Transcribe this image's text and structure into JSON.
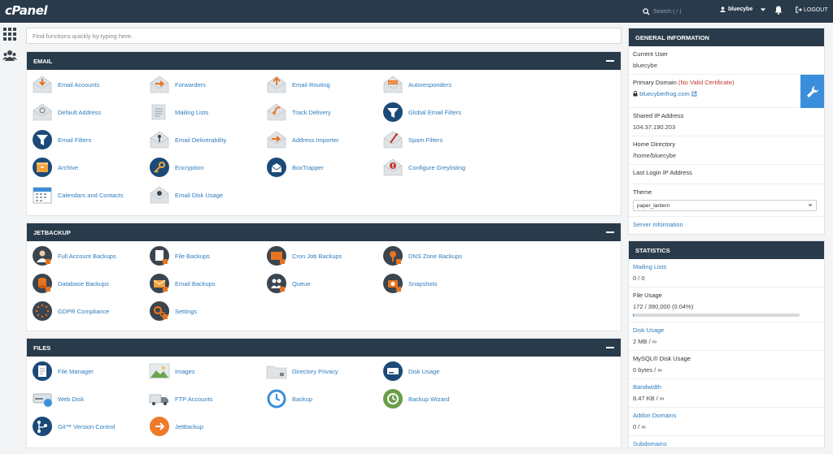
{
  "topbar": {
    "logo": "cPanel",
    "search_placeholder": "Search ( / )",
    "username": "bluecybe",
    "logout": "LOGOUT"
  },
  "quick_search": {
    "placeholder": "Find functions quickly by typing here."
  },
  "sections": [
    {
      "title": "EMAIL",
      "items": [
        {
          "label": "Email Accounts",
          "icon": "envelope-arrow-down-icon"
        },
        {
          "label": "Forwarders",
          "icon": "envelope-arrow-right-icon"
        },
        {
          "label": "Email Routing",
          "icon": "envelope-route-icon"
        },
        {
          "label": "Autoresponders",
          "icon": "envelope-auto-icon"
        },
        {
          "label": "Default Address",
          "icon": "envelope-at-icon"
        },
        {
          "label": "Mailing Lists",
          "icon": "envelope-list-icon"
        },
        {
          "label": "Track Delivery",
          "icon": "envelope-track-icon"
        },
        {
          "label": "Global Email Filters",
          "icon": "globe-filter-icon"
        },
        {
          "label": "Email Filters",
          "icon": "funnel-icon"
        },
        {
          "label": "Email Deliverability",
          "icon": "envelope-key-icon"
        },
        {
          "label": "Address Importer",
          "icon": "envelope-import-icon"
        },
        {
          "label": "Spam Filters",
          "icon": "envelope-spam-icon"
        },
        {
          "label": "Archive",
          "icon": "archive-icon"
        },
        {
          "label": "Encryption",
          "icon": "key-icon"
        },
        {
          "label": "BoxTrapper",
          "icon": "boxtrapper-icon"
        },
        {
          "label": "Configure Greylisting",
          "icon": "greylisting-icon"
        },
        {
          "label": "Calendars and Contacts",
          "icon": "calendar-icon"
        },
        {
          "label": "Email Disk Usage",
          "icon": "envelope-disk-icon"
        }
      ]
    },
    {
      "title": "JETBACKUP",
      "items": [
        {
          "label": "Full Account Backups",
          "icon": "user-backup-icon"
        },
        {
          "label": "File Backups",
          "icon": "file-backup-icon"
        },
        {
          "label": "Cron Job Backups",
          "icon": "cron-backup-icon"
        },
        {
          "label": "DNS Zone Backups",
          "icon": "dns-backup-icon"
        },
        {
          "label": "Database Backups",
          "icon": "database-backup-icon"
        },
        {
          "label": "Email Backups",
          "icon": "email-backup-icon"
        },
        {
          "label": "Queue",
          "icon": "queue-icon"
        },
        {
          "label": "Snapshots",
          "icon": "snapshot-icon"
        },
        {
          "label": "GDPR Compliance",
          "icon": "gdpr-icon"
        },
        {
          "label": "Settings",
          "icon": "settings-gear-icon"
        }
      ]
    },
    {
      "title": "FILES",
      "items": [
        {
          "label": "File Manager",
          "icon": "file-manager-icon"
        },
        {
          "label": "Images",
          "icon": "image-icon"
        },
        {
          "label": "Directory Privacy",
          "icon": "folder-lock-icon"
        },
        {
          "label": "Disk Usage",
          "icon": "disk-usage-icon"
        },
        {
          "label": "Web Disk",
          "icon": "web-disk-icon"
        },
        {
          "label": "FTP Accounts",
          "icon": "ftp-truck-icon"
        },
        {
          "label": "Backup",
          "icon": "backup-clock-icon"
        },
        {
          "label": "Backup Wizard",
          "icon": "backup-wizard-icon"
        },
        {
          "label": "Git™ Version Control",
          "icon": "git-icon"
        },
        {
          "label": "JetBackup",
          "icon": "jetbackup-icon"
        }
      ]
    }
  ],
  "general": {
    "title": "GENERAL INFORMATION",
    "current_user_label": "Current User",
    "current_user": "bluecybe",
    "primary_domain_label": "Primary Domain",
    "no_cert": "(No Valid Certificate)",
    "domain": "bluecyberfrog.com",
    "shared_ip_label": "Shared IP Address",
    "shared_ip": "104.37.190.203",
    "home_dir_label": "Home Directory",
    "home_dir": "/home/bluecybe",
    "last_login_label": "Last Login IP Address",
    "theme_label": "Theme",
    "theme_value": "paper_lantern",
    "server_info": "Server Information"
  },
  "statistics": {
    "title": "STATISTICS",
    "rows": [
      {
        "label": "Mailing Lists",
        "value": "0 / 0",
        "link": true
      },
      {
        "label": "File Usage",
        "value": "172 / 390,000   (0.04%)",
        "link": false,
        "bar": 0.0004
      },
      {
        "label": "Disk Usage",
        "value": "2 MB / ∞",
        "link": true
      },
      {
        "label": "MySQL® Disk Usage",
        "value": "0 bytes / ∞",
        "link": false
      },
      {
        "label": "Bandwidth",
        "value": "8.47 KB / ∞",
        "link": true
      },
      {
        "label": "Addon Domains",
        "value": "0 / ∞",
        "link": true
      },
      {
        "label": "Subdomains",
        "value": "",
        "link": true
      }
    ]
  },
  "colors": {
    "header": "#293a4a",
    "link": "#2d7cbd",
    "accent": "#3b8edb",
    "warning": "#c0392b"
  }
}
